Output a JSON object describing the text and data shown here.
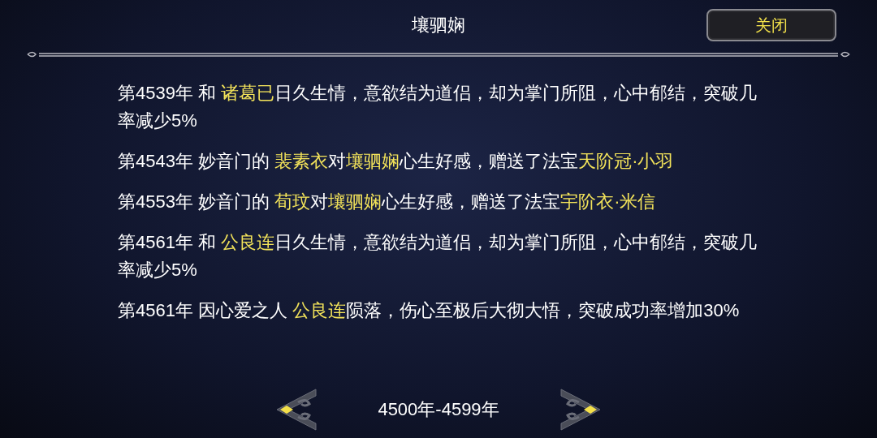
{
  "title": "壤驷娴",
  "close_button": "关闭",
  "entries": [
    {
      "segments": [
        {
          "text": "第4539年 和 ",
          "highlight": false
        },
        {
          "text": "诸葛已",
          "highlight": true
        },
        {
          "text": "日久生情，意欲结为道侣，却为掌门所阻，心中郁结，突破几率减少5%",
          "highlight": false
        }
      ]
    },
    {
      "segments": [
        {
          "text": "第4543年 妙音门的 ",
          "highlight": false
        },
        {
          "text": "裴素衣",
          "highlight": true
        },
        {
          "text": "对",
          "highlight": false
        },
        {
          "text": "壤驷娴",
          "highlight": true
        },
        {
          "text": "心生好感，赠送了法宝",
          "highlight": false
        },
        {
          "text": "天阶冠·小羽",
          "highlight": true
        }
      ]
    },
    {
      "segments": [
        {
          "text": "第4553年 妙音门的 ",
          "highlight": false
        },
        {
          "text": "荀玟",
          "highlight": true
        },
        {
          "text": "对",
          "highlight": false
        },
        {
          "text": "壤驷娴",
          "highlight": true
        },
        {
          "text": "心生好感，赠送了法宝",
          "highlight": false
        },
        {
          "text": "宇阶衣·米信",
          "highlight": true
        }
      ]
    },
    {
      "segments": [
        {
          "text": "第4561年 和 ",
          "highlight": false
        },
        {
          "text": "公良连",
          "highlight": true
        },
        {
          "text": "日久生情，意欲结为道侣，却为掌门所阻，心中郁结，突破几率减少5%",
          "highlight": false
        }
      ]
    },
    {
      "segments": [
        {
          "text": "第4561年 因心爱之人 ",
          "highlight": false
        },
        {
          "text": "公良连",
          "highlight": true
        },
        {
          "text": "陨落，伤心至极后大彻大悟，突破成功率增加30%",
          "highlight": false
        }
      ]
    }
  ],
  "pager": {
    "range": "4500年-4599年"
  }
}
